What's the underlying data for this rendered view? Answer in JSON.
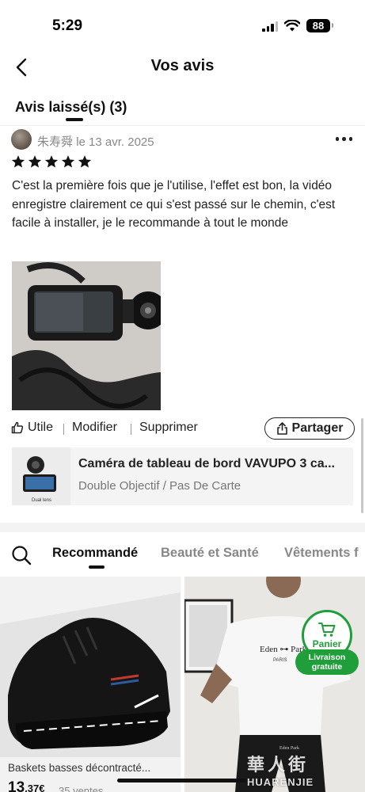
{
  "status_bar": {
    "time": "5:29",
    "battery": "88"
  },
  "nav": {
    "title": "Vos avis",
    "back_icon": "chevron-left-icon"
  },
  "tabs": {
    "left_label": "Avis laissé(s) (3)"
  },
  "review": {
    "reviewer_name": "朱寿舜",
    "date_text": "le 13 avr. 2025",
    "rating": 5,
    "text": "C'est la première fois que je l'utilise, l'effet est bon, la vidéo enregistre clairement ce qui s'est passé sur le chemin, c'est facile à installer, je le recommande à tout le monde",
    "actions": {
      "helpful": "Utile",
      "edit": "Modifier",
      "delete": "Supprimer",
      "share": "Partager"
    },
    "product": {
      "name": "Caméra de tableau de bord VAVUPO 3 ca...",
      "variant": "Double Objectif / Pas De Carte",
      "thumb_caption": "Dual lens"
    }
  },
  "recommendations": {
    "tabs": [
      "Recommandé",
      "Beauté et Santé",
      "Vêtements f"
    ],
    "active_tab": "Recommandé",
    "cards": [
      {
        "title": "Baskets basses décontracté...",
        "price_main": "13",
        "price_cents": ",37€",
        "sold": "35 ventes"
      },
      {
        "shirt_brand": "Eden ⊶ Park",
        "shirt_sub": "PARIS",
        "shorts_brand": "Eden Park"
      }
    ]
  },
  "cart": {
    "label": "Panier",
    "badge_line1": "Livraison",
    "badge_line2": "gratuite"
  },
  "watermark": {
    "logo": "華人街",
    "text": "HUARENJIE"
  },
  "colors": {
    "accent_green": "#1f9e3a",
    "text_dark": "#222222",
    "text_muted": "#888888"
  }
}
